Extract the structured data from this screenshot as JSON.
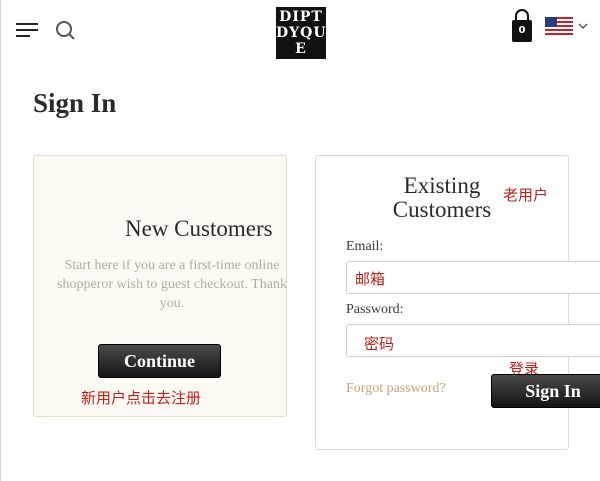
{
  "header": {
    "logo_lines": [
      "DIPT",
      "DYQU",
      "E"
    ],
    "bag_count": "0",
    "icons": [
      "menu-icon",
      "search-icon",
      "shopping-bag-icon",
      "us-flag-icon",
      "chevron-down-icon"
    ]
  },
  "page": {
    "title": "Sign In"
  },
  "new_customers": {
    "heading": "New Customers",
    "description": "Start here if you are a first-time online shopperor wish to guest checkout. Thank you.",
    "continue_label": "Continue",
    "annotation": "新用户点击去注册"
  },
  "existing_customers": {
    "heading_line1": "Existing",
    "heading_line2": "Customers",
    "annotation": "老用户",
    "email_label": "Email:",
    "email_placeholder": "邮箱",
    "password_label": "Password:",
    "password_placeholder": "密码",
    "login_annotation": "登录",
    "forgot_label": "Forgot password?",
    "signin_label": "Sign In"
  },
  "colors": {
    "annotation": "#c2201c",
    "forgot_link": "#c4a47a",
    "panel_bg": "#fdf9f3",
    "button_dark": "#1a1a1a"
  }
}
